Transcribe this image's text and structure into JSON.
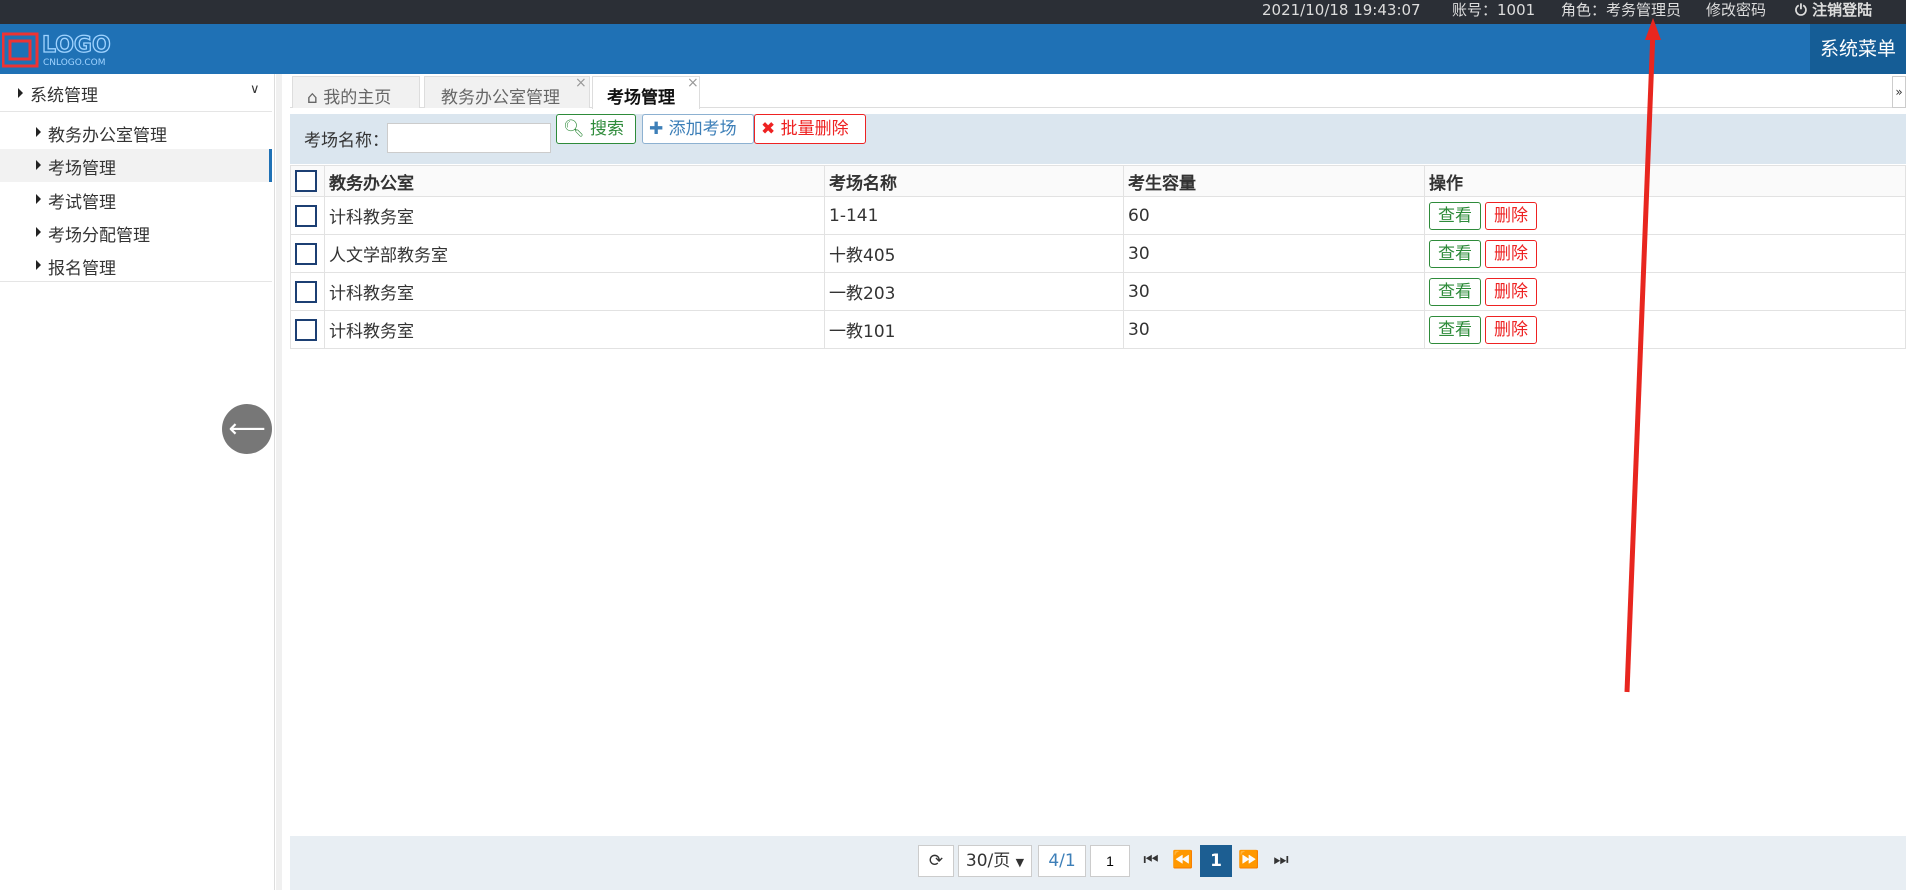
{
  "topbar": {
    "datetime": "2021/10/18 19:43:07",
    "account": "账号：1001",
    "role": "角色：考务管理员",
    "change_password": "修改密码",
    "logout": "注销登陆"
  },
  "header": {
    "logo_text": "LOGO",
    "logo_subtext": "CNLOGO.COM",
    "system_menu": "系统菜单"
  },
  "sidebar": {
    "group_label": "系统管理",
    "items": [
      {
        "label": "教务办公室管理"
      },
      {
        "label": "考场管理"
      },
      {
        "label": "考试管理"
      },
      {
        "label": "考场分配管理"
      },
      {
        "label": "报名管理"
      }
    ],
    "active_item": "考场管理"
  },
  "tabs": [
    {
      "label": "我的主页",
      "icon": "home-icon"
    },
    {
      "label": "教务办公室管理",
      "close": "×"
    },
    {
      "label": "考场管理",
      "close": "×"
    }
  ],
  "toolbar": {
    "search_label": "考场名称：",
    "search_value": "",
    "search_button": "搜索",
    "add_button": "添加考场",
    "batch_delete_button": "批量删除"
  },
  "table": {
    "headers": [
      "教务办公室",
      "考场名称",
      "考生容量",
      "操作"
    ],
    "rows": [
      {
        "office": "计科教务室",
        "room": "1-141",
        "capacity": "60"
      },
      {
        "office": "人文学部教务室",
        "room": "十教405",
        "capacity": "30"
      },
      {
        "office": "计科教务室",
        "room": "一教203",
        "capacity": "30"
      },
      {
        "office": "计科教务室",
        "room": "一教101",
        "capacity": "30"
      }
    ],
    "view_label": "查看",
    "delete_label": "删除"
  },
  "pager": {
    "page_size": "30/页",
    "page_info": "4/1",
    "page_input": "1",
    "current_page": "1"
  },
  "colors": {
    "header_bg": "#1f71b5",
    "topbar_bg": "#2b2f36",
    "annotation_arrow": "#e8261f"
  }
}
